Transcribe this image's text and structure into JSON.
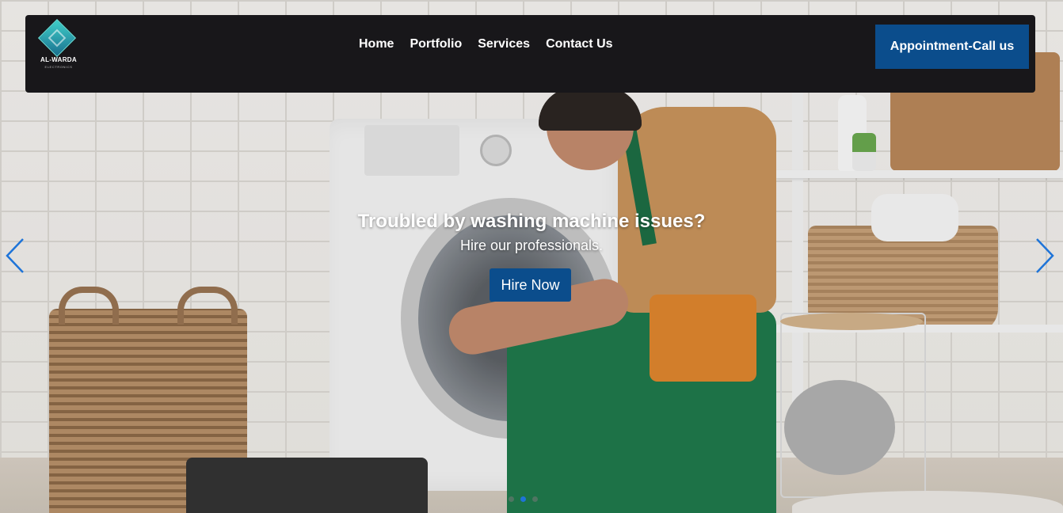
{
  "brand": {
    "name": "AL-WARDA",
    "subtitle": "ELECTRONICS",
    "accent": "#0b4d8c"
  },
  "nav": {
    "links": [
      {
        "label": "Home"
      },
      {
        "label": "Portfolio"
      },
      {
        "label": "Services"
      },
      {
        "label": "Contact Us"
      }
    ],
    "cta_label": "Appointment-Call us"
  },
  "hero": {
    "headline": "Troubled by washing machine issues?",
    "subheadline": "Hire our professionals.",
    "button_label": "Hire Now",
    "prev_icon": "chevron-left-icon",
    "next_icon": "chevron-right-icon",
    "slides_count": 3,
    "active_slide": 2,
    "arrow_color": "#1e74d8"
  }
}
